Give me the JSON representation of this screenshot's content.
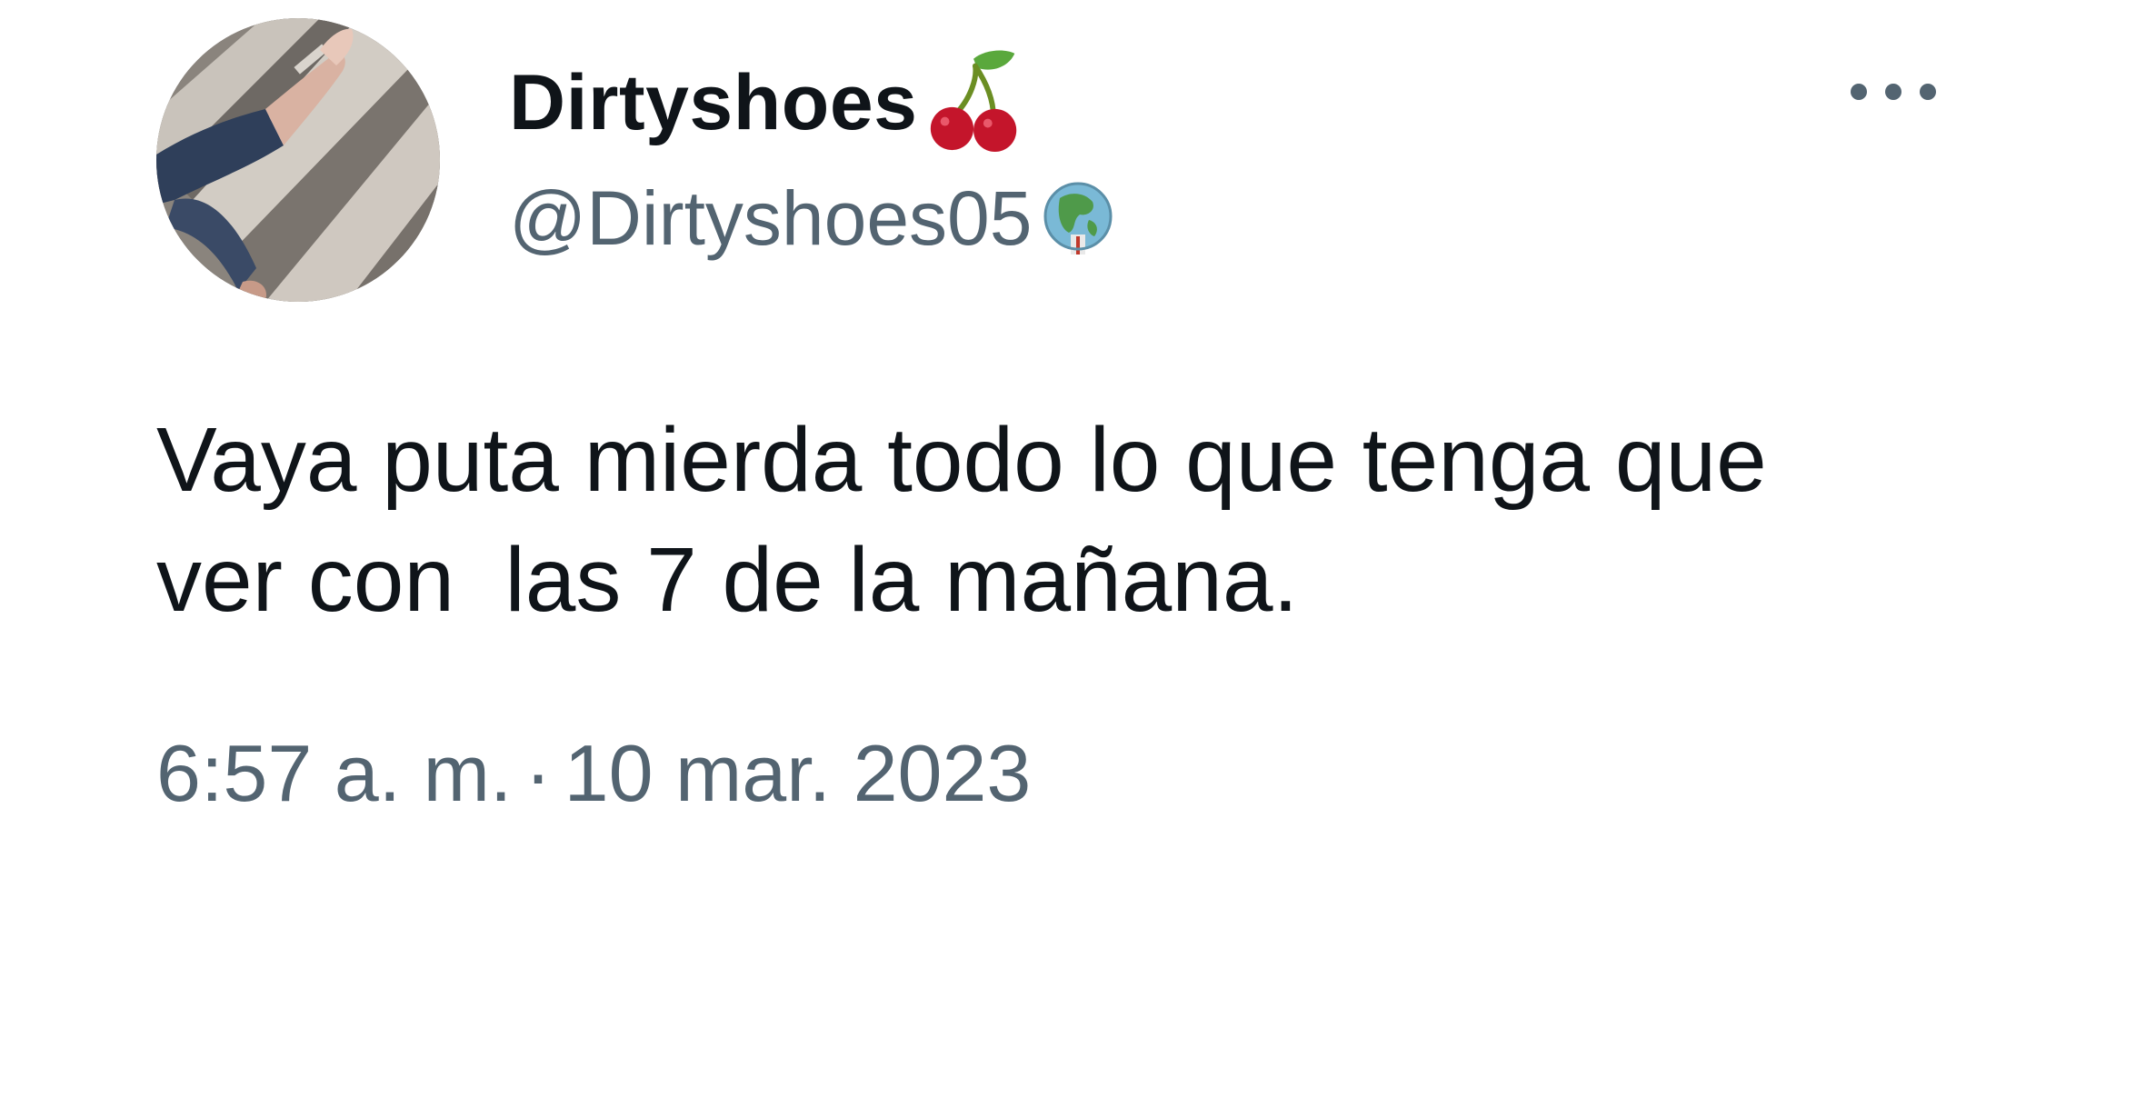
{
  "tweet": {
    "display_name": "Dirtyshoes",
    "display_name_emoji": "cherries-emoji",
    "handle": "@Dirtyshoes05",
    "handle_emoji": "globe-icon",
    "more_icon": "more-horizontal-icon",
    "text": "Vaya puta mierda todo lo que tenga que\nver con  las 7 de la mañana.",
    "time": "6:57 a. m.",
    "separator": "·",
    "date": "10 mar. 2023"
  },
  "colors": {
    "text_primary": "#0f1419",
    "text_secondary": "#536471",
    "background": "#ffffff"
  }
}
